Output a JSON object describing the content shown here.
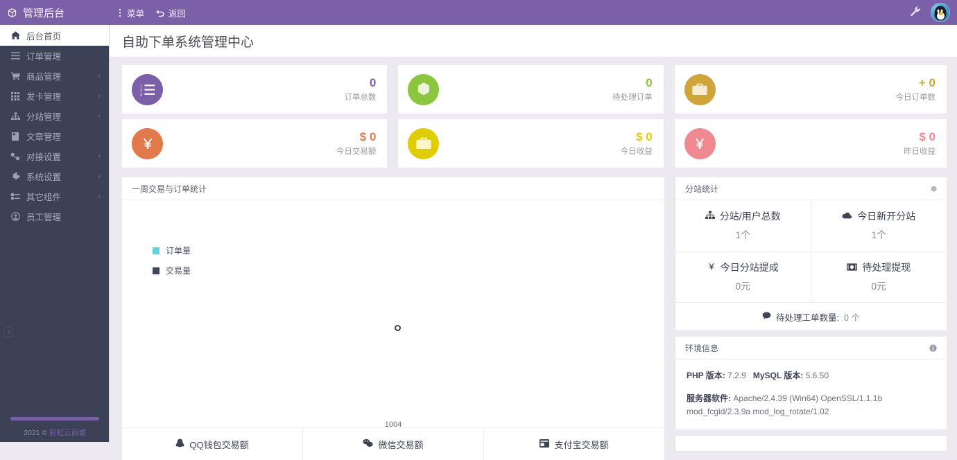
{
  "topbar": {
    "brand": "管理后台",
    "brand_icon": "cube-icon",
    "menu_label": "菜单",
    "menu_icon": "dots-vertical-icon",
    "back_label": "返回",
    "back_icon": "undo-arrow-icon",
    "wrench_icon": "wrench-icon",
    "avatar_icon": "qq-penguin-avatar",
    "bg_color": "#7b5fa8"
  },
  "sidebar": {
    "bg_color": "#3b4256",
    "items": [
      {
        "label": "后台首页",
        "icon": "home-icon",
        "active": true,
        "arrow": ""
      },
      {
        "label": "订单管理",
        "icon": "list-icon",
        "active": false,
        "arrow": ""
      },
      {
        "label": "商品管理",
        "icon": "cart-icon",
        "active": false,
        "arrow": "‹"
      },
      {
        "label": "发卡管理",
        "icon": "grid-icon",
        "active": false,
        "arrow": "‹"
      },
      {
        "label": "分站管理",
        "icon": "sitemap-icon",
        "active": false,
        "arrow": "‹"
      },
      {
        "label": "文章管理",
        "icon": "book-icon",
        "active": false,
        "arrow": ""
      },
      {
        "label": "对接设置",
        "icon": "plug-icon",
        "active": false,
        "arrow": "‹"
      },
      {
        "label": "系统设置",
        "icon": "gear-icon",
        "active": false,
        "arrow": "‹"
      },
      {
        "label": "其它组件",
        "icon": "puzzle-icon",
        "active": false,
        "arrow": "‹"
      },
      {
        "label": "员工管理",
        "icon": "user-circle-icon",
        "active": false,
        "arrow": ""
      }
    ],
    "collapse_icon": "collapse-icon",
    "footer_year": "2021 © ",
    "footer_link": "彩虹云商城"
  },
  "page": {
    "title": "自助下单系统管理中心"
  },
  "stats": [
    {
      "icon": "ordered-list-icon",
      "color": "#7c5fa9",
      "value": "0",
      "label": "订单总数"
    },
    {
      "icon": "hexagon-icon",
      "color": "#8cc63f",
      "value": "0",
      "label": "待处理订单"
    },
    {
      "icon": "briefcase-icon",
      "color": "#cfa439",
      "value": "+ 0",
      "label": "今日订单数"
    },
    {
      "icon": "yen-icon",
      "color": "#e2794a",
      "value": "$ 0",
      "label": "今日交易额"
    },
    {
      "icon": "briefcase-icon",
      "color": "#e0cc05",
      "value": "$ 0",
      "label": "今日收益"
    },
    {
      "icon": "yen-icon",
      "color": "#f08a90",
      "value": "$ 0",
      "label": "昨日收益"
    }
  ],
  "chart_panel": {
    "title": "一周交易与订单统计",
    "tabs": [
      {
        "label": "QQ钱包交易额",
        "icon": "qq-icon"
      },
      {
        "label": "微信交易额",
        "icon": "wechat-icon"
      },
      {
        "label": "支付宝交易额",
        "icon": "alipay-icon"
      }
    ]
  },
  "chart_data": {
    "type": "line",
    "title": "一周交易与订单统计",
    "xlabel": "",
    "ylabel": "",
    "x": [
      "1004"
    ],
    "categories": [
      "1004"
    ],
    "series": [
      {
        "name": "订单量",
        "color": "#63d2dd",
        "values": [
          0
        ]
      },
      {
        "name": "交易量",
        "color": "#3d4757",
        "values": [
          0
        ]
      }
    ],
    "legend": [
      "订单量",
      "交易量"
    ],
    "legend_position": "top-left",
    "grid": false
  },
  "substation": {
    "title": "分站统计",
    "head_icon": "circle-dot-icon",
    "cells": [
      {
        "icon": "sitemap-icon",
        "label": "分站/用户总数",
        "value": "1个"
      },
      {
        "icon": "cloud-icon",
        "label": "今日新开分站",
        "value": "1个"
      },
      {
        "icon": "yen-icon",
        "label": "今日分站提成",
        "value": "0元"
      },
      {
        "icon": "money-icon",
        "label": "待处理提现",
        "value": "0元"
      }
    ],
    "footer_icon": "comment-icon",
    "footer_label": "待处理工单数量:",
    "footer_value": "0 个"
  },
  "environment": {
    "title": "环境信息",
    "head_icon": "info-icon",
    "rows": [
      {
        "key": "PHP 版本:",
        "value": "7.2.9",
        "key2": "MySQL 版本:",
        "value2": "5.6.50"
      },
      {
        "key": "服务器软件:",
        "value": "Apache/2.4.39 (Win64) OpenSSL/1.1.1b mod_fcgid/2.3.9a mod_log_rotate/1.02"
      }
    ]
  }
}
